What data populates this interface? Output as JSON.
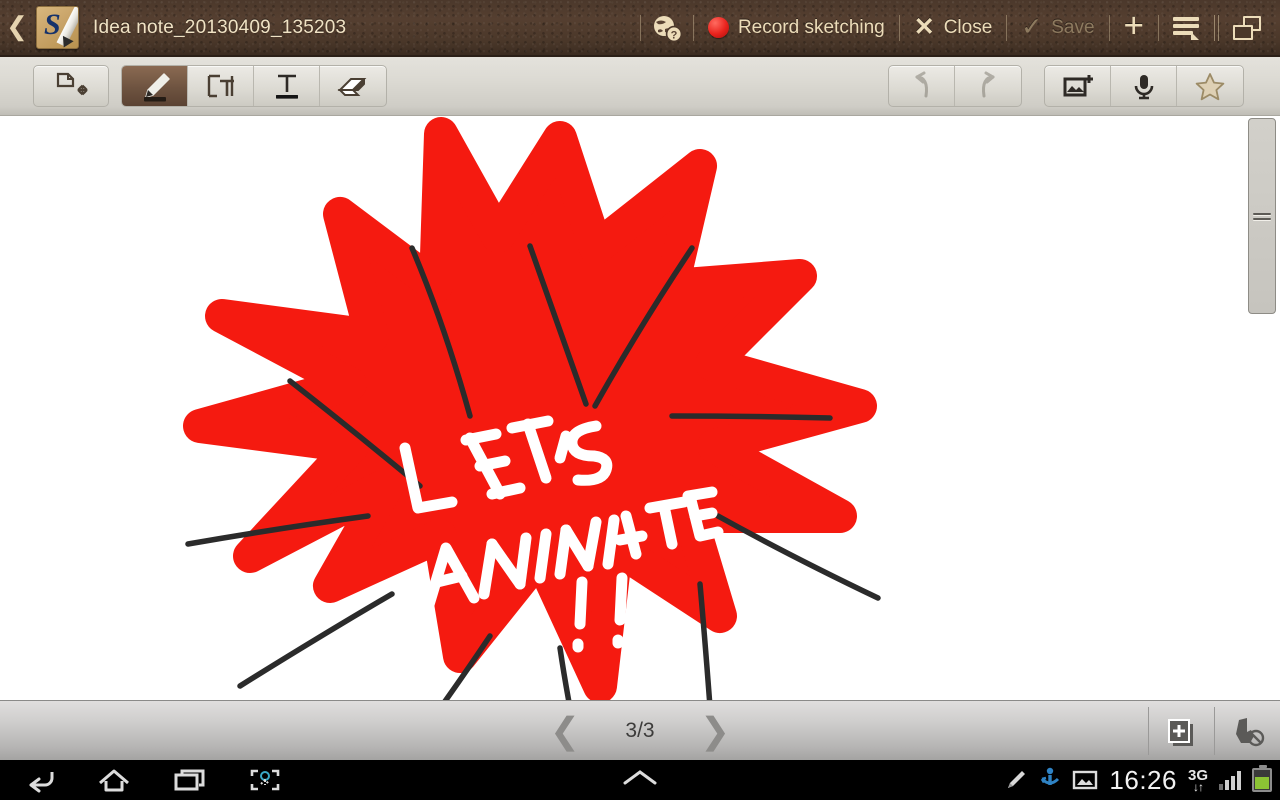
{
  "app": {
    "name": "S Note",
    "icon": "snote-app-icon"
  },
  "titlebar": {
    "back_icon": "back-chevron-icon",
    "document_title": "Idea note_20130409_135203",
    "help_icon": "globe-help-icon",
    "record_label": "Record sketching",
    "record_icon": "record-dot-icon",
    "close_label": "Close",
    "close_icon": "close-x-icon",
    "save_label": "Save",
    "save_icon": "check-icon",
    "save_enabled": false,
    "add_icon": "plus-icon",
    "menu_icon": "list-menu-icon",
    "multiwindow_icon": "cascade-windows-icon",
    "text_color": "#ecdcb9",
    "disabled_color": "#8d7a5f",
    "bar_color": "#4b382b"
  },
  "toolbar": {
    "select_move": {
      "label": "Select and move",
      "icon": "select-move-icon",
      "active": false
    },
    "tools": [
      {
        "label": "Pen",
        "icon": "pen-icon",
        "active": true
      },
      {
        "label": "Text box",
        "icon": "text-box-icon",
        "active": false
      },
      {
        "label": "Text",
        "icon": "text-icon",
        "active": false
      },
      {
        "label": "Eraser",
        "icon": "eraser-icon",
        "active": false
      }
    ],
    "undo": {
      "label": "Undo",
      "icon": "undo-icon",
      "enabled": false
    },
    "redo": {
      "label": "Redo",
      "icon": "redo-icon",
      "enabled": false
    },
    "extras": [
      {
        "label": "Insert image",
        "icon": "image-add-icon"
      },
      {
        "label": "Voice record",
        "icon": "microphone-icon"
      },
      {
        "label": "Favorite",
        "icon": "star-icon"
      }
    ],
    "active_color": "#6e5340"
  },
  "canvas": {
    "background": "#ffffff",
    "sketch": {
      "description": "Hand-drawn red starburst with black outline strokes",
      "burst_color": "#f51a10",
      "outline_color": "#2b2b2b",
      "handwriting_color": "#ffffff",
      "handwritten_text_line1": "LET'S",
      "handwritten_text_line2": "ANIMATE",
      "handwritten_text_line3": "!!"
    },
    "scrollbar": {
      "name": "vertical-scrollbar",
      "grip_icon": "grip-lines-icon"
    }
  },
  "bottombar": {
    "prev_icon": "chevron-left-icon",
    "next_icon": "chevron-right-icon",
    "page_label": "3/3",
    "current_page": 3,
    "total_pages": 3,
    "add_page": {
      "label": "Add page",
      "icon": "add-page-icon"
    },
    "palm_reject": {
      "label": "Disable touch input",
      "icon": "hand-disabled-icon"
    }
  },
  "systemnav": {
    "back_icon": "android-back-icon",
    "home_icon": "android-home-icon",
    "recents_icon": "android-recents-icon",
    "screenshot_icon": "android-screenshot-icon",
    "up_icon": "android-chevron-up-icon",
    "status": {
      "pen_icon": "spen-icon",
      "sync_icon": "spen-detached-icon",
      "image_icon": "screenshot-saved-icon",
      "time": "16:26",
      "network": "3G",
      "network_arrows": "↓↑",
      "signal_icon": "signal-bars-icon",
      "battery_icon": "battery-icon",
      "battery_color": "#8bc334"
    }
  }
}
